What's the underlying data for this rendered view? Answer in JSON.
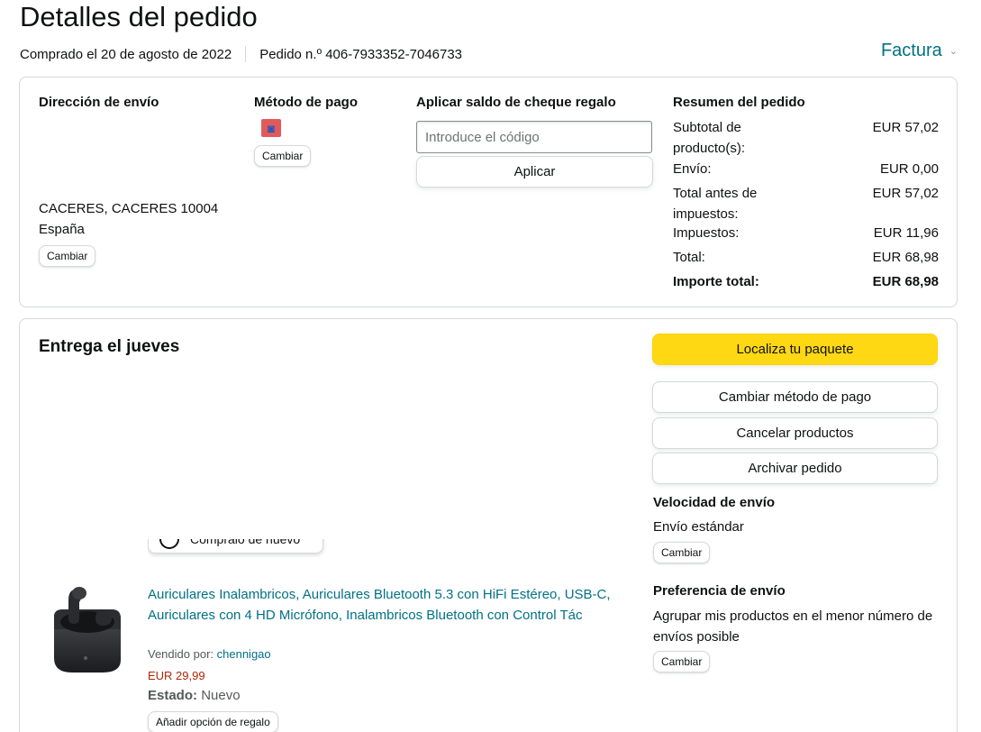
{
  "header": {
    "title": "Detalles del pedido",
    "purchased": "Comprado el 20 de agosto de 2022",
    "order_number": "Pedido n.º 406-7933352-7046733",
    "invoice_label": "Factura"
  },
  "shipping_address": {
    "heading": "Dirección de envío",
    "city_line": "CACERES, CACERES 10004",
    "country": "España",
    "change_label": "Cambiar"
  },
  "payment": {
    "heading": "Método de pago",
    "icon": "payment-card-icon",
    "change_label": "Cambiar"
  },
  "gift_card": {
    "heading": "Aplicar saldo de cheque regalo",
    "placeholder": "Introduce el código",
    "value": "",
    "apply_label": "Aplicar"
  },
  "summary": {
    "heading": "Resumen del pedido",
    "rows": [
      {
        "label": "Subtotal de producto(s):",
        "value": "EUR 57,02"
      },
      {
        "label": "Envío:",
        "value": "EUR 0,00"
      },
      {
        "label": "Total antes de impuestos:",
        "value": "EUR 57,02"
      },
      {
        "label": "Impuestos:",
        "value": "EUR 11,96"
      },
      {
        "label": "Total:",
        "value": "EUR 68,98"
      }
    ],
    "grand_total_label": "Importe total:",
    "grand_total_value": "EUR 68,98"
  },
  "delivery": {
    "heading": "Entrega el jueves",
    "buy_again_label": "Cómpralo de nuevo",
    "product": {
      "title": "Auriculares Inalambricos, Auriculares Bluetooth 5.3 con HiFi Estéreo, USB-C, Auriculares con 4 HD Micrófono, Inalambricos Bluetooth con Control Tác",
      "sold_by_label": "Vendido por:",
      "seller": "chennigao",
      "price": "EUR 29,99",
      "state_label": "Estado:",
      "state_value": "Nuevo",
      "gift_option_label": "Añadir opción de regalo"
    }
  },
  "actions": {
    "track": "Localiza tu paquete",
    "change_payment": "Cambiar método de pago",
    "cancel": "Cancelar productos",
    "archive": "Archivar pedido"
  },
  "shipping_speed": {
    "heading": "Velocidad de envío",
    "value": "Envío estándar",
    "change_label": "Cambiar"
  },
  "shipping_pref": {
    "heading": "Preferencia de envío",
    "value": "Agrupar mis productos en el menor número de envíos posible",
    "change_label": "Cambiar"
  },
  "colors": {
    "primary_button": "#ffd814",
    "link": "#007185",
    "price": "#b12704"
  }
}
